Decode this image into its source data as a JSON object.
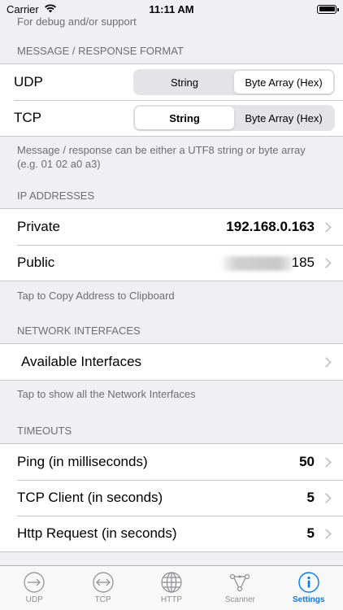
{
  "status_bar": {
    "carrier": "Carrier",
    "time": "11:11 AM"
  },
  "top_footer": "For debug and/or support",
  "message_format": {
    "header": "MESSAGE / RESPONSE FORMAT",
    "rows": [
      {
        "label": "UDP",
        "options": [
          "String",
          "Byte Array (Hex)"
        ],
        "selected": "Byte Array (Hex)"
      },
      {
        "label": "TCP",
        "options": [
          "String",
          "Byte Array (Hex)"
        ],
        "selected": "String"
      }
    ],
    "footer": "Message / response can be either a UTF8 string or byte array (e.g. 01 02 a0 a3)"
  },
  "ip_addresses": {
    "header": "IP ADDRESSES",
    "private_label": "Private",
    "private_value": "192.168.0.163",
    "public_label": "Public",
    "public_value_visible": "185",
    "footer": "Tap to Copy Address to Clipboard"
  },
  "network_interfaces": {
    "header": "NETWORK INTERFACES",
    "row_label": "Available Interfaces",
    "footer": "Tap to show all the Network Interfaces"
  },
  "timeouts": {
    "header": "TIMEOUTS",
    "ping_label": "Ping (in milliseconds)",
    "ping_value": "50",
    "tcp_label": "TCP Client (in seconds)",
    "tcp_value": "5",
    "http_label": "Http Request (in seconds)",
    "http_value": "5"
  },
  "tab_bar": {
    "udp": "UDP",
    "tcp": "TCP",
    "http": "HTTP",
    "scanner": "Scanner",
    "settings": "Settings",
    "active": "Settings",
    "active_color": "#007aff",
    "inactive_color": "#8e8e93"
  }
}
